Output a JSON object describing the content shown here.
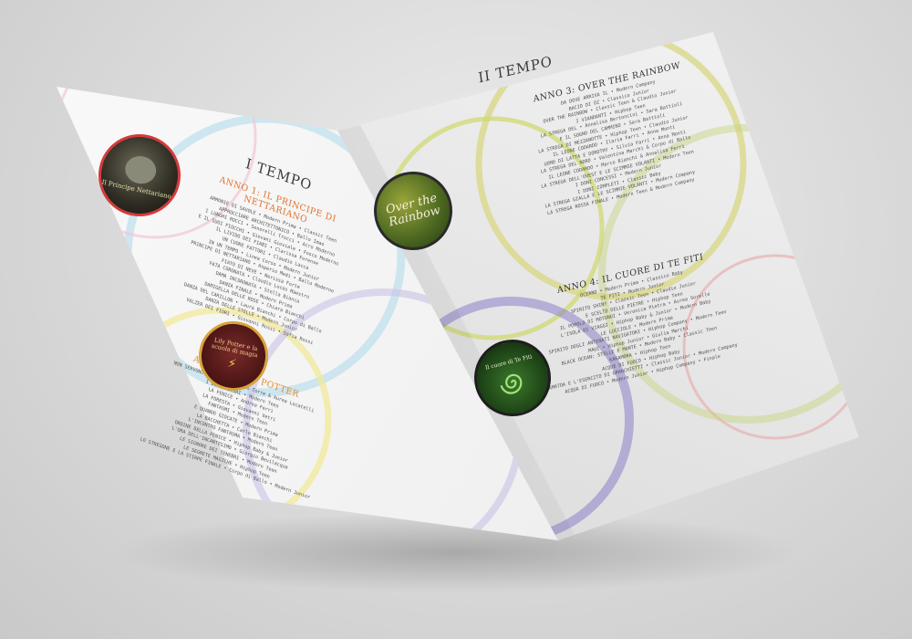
{
  "left_page": {
    "title": "I TEMPO",
    "sections": [
      {
        "title": "ANNO 1: IL PRINCIPE DI NETTARIANO",
        "color": "#e1702a",
        "badge_text": "Il Principe Nettariano",
        "lines": [
          "ARMONIE DI SAVOLE • Modern Prima • Classic Teen",
          "APPROCCIARE ARCHITETTONICO • Ballo Imao",
          "I LUNGHI ROCCI • Sonorelli Trocci • Acro Moderno",
          "E IL SUOI FIOCCHI • Giovani Gioviale • Fosco Moderno",
          "IL LIVIDO DEI FIABI • Clarissa Forense",
          "UN CUORE FATTORI • Claudio Lacca",
          "IN UN TEMPO • Linea Corso • Modern Junior",
          "PRINCIPE DI NETTARIANO • Asperio Medi • Ballo Moderno",
          "FIATO DI NEVE • Nerissa Forte",
          "FATA CORONATA • Claudio Lucas Maestro",
          "DAMA INCORONATA • Stella Bianca",
          "DANZA FINALE • Modern Prima",
          "DAMIGELLA DELLE ROSE • Chiara Bianchi",
          "DANZA DEL CARILLON • Laura Bianchi • Corpo di Ballo",
          "DANZA DELLE STELLE • Modern Junior",
          "VALZER DEI FIORI • Giovanni Rossi • Sofia Rossi"
        ]
      },
      {
        "title": "ANNO 2: LILY POTTER",
        "color": "#e18b2a",
        "badge_text": "Lily Potter e la scuola di magia",
        "lines": [
          "NON SERVONO LIBRI • Leonardo Torre & Aurea Locatelli",
          "I DONI OSCURI • Modern Teen",
          "LA FENICE • Andrea Ferri",
          "LA FORESTA • Giovanni Vetri",
          "FANTASMI • Modern Teen",
          "E QUANDO GIOCATE • Modern Prima",
          "LA BACCHETTA • Carlo Bianchi",
          "L'INCONTRO FANTASMA • Modern Teen",
          "ORDINE DELLA FENICE • Hiphop Baby & Junior",
          "L'ORA DELL'INCANTESIMO • Giorgio Bevilacqua",
          "LE SIGNORE DEI TENEBRI • Modern Teen",
          "LE SEGRETE MAGICHE • Hiphop Teen",
          "LO STREGONE E LA STIRPE FINALE • Corpo di Ballo • Modern Junior"
        ]
      }
    ]
  },
  "right_page": {
    "title": "II TEMPO",
    "sections": [
      {
        "title": "ANNO 3: OVER THE RAINBOW",
        "color": "#333333",
        "badge_text": "Over the Rainbow",
        "lines": [
          "DA DOVE ARRIVA IL • Modern Company",
          "BACIO DI OZ • Classico Junior",
          "OVER THE RAINBOW • Classic Teen & Claudio Junior",
          "I VIANDANTI • Hiphop Teen",
          "LA STREGA DEL • Annalisa Bertoncini • Sara Battioli",
          "E IL SOGNO DEL CAMMINO • Sara Battioli",
          "LA STREGA DI MEZZANOTTE • Hiphop Teen • Claudio Junior",
          "IL LEONE CODARDO • Ilaria Farri • Anna Monti",
          "UOMO DI LATTA E DOROTHY • Silvia Farri • Anna Monti",
          "LA STREGA DEL NORD • Valentina Marchi & Corpo di Ballo",
          "IL LEONE CODARDO • Marco Bianchi & Annalisa Ferri",
          "LA STREGA DELL'OVEST E LE SCIMMIE VOLANTI • Modern Teen",
          "I DONI CONCESSI • Modern Junior",
          "I DONI COMPLETI • Classic Baby",
          "LA STREGA GIALLA E LE SCIMMIE VOLANTI • Modern Company",
          "LA STREGA ROSSA FINALE • Modern Teen & Modern Company"
        ]
      },
      {
        "title": "ANNO 4: IL CUORE DI TE FITI",
        "color": "#333333",
        "badge_text": "Il cuore di Te Fiti",
        "lines": [
          "OCEANO • Modern Prima • Classico Baby",
          "TE FITI • Modern Junior",
          "SPIRITO SHINY • Classic Teen • Claudio Junior",
          "E SCELTO DELLE PIETRE • Hiphop Teen",
          "IL POPOLO DI MOTUNUI • Veronica Pietra • Aurea Sorelle",
          "L'ISOLA DI VIAGGI • Hiphop Baby & Junior • Modern Baby",
          "LE LUCCIOLE • Modern Prima",
          "SPIRITO DEGLI ANTENATI NAVIGATORI • Hiphop Company • Modern Teen",
          "MAUI • Hiphop Junior • Giulia Marchi",
          "BLACK OCEAN: STELLE E MANTE • Modern Baby • Classic Teen",
          "KAKAMORA • Hiphop Teen",
          "ACQUE DI FUOCO • Hiphop Baby",
          "TAMATOA E L'ESERCITO DI GRANCHIETTI • Classic Junior • Modern Company",
          "ACQUA DI FUOCO • Modern Junior • Hiphop Company • Finale"
        ]
      }
    ]
  }
}
